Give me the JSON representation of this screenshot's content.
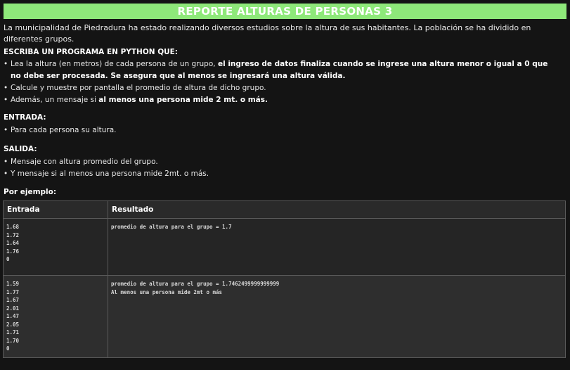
{
  "title": "REPORTE ALTURAS DE PERSONAS 3",
  "intro": "La municipalidad de Piedradura ha estado realizando diversos estudios sobre la altura de sus habitantes. La población se ha dividido en diferentes grupos.",
  "program_heading": "ESCRIBA UN PROGRAMA EN PYTHON QUE:",
  "program_items": [
    {
      "pre": "Lea la altura (en metros) de cada persona de un grupo, ",
      "bold": "el ingreso de datos finaliza cuando se ingrese una altura menor o igual a 0 que no debe ser procesada. Se asegura que al menos se ingresará una altura válida."
    },
    {
      "pre": "Calcule y muestre por pantalla el promedio de altura de dicho grupo.",
      "bold": ""
    },
    {
      "pre": "Además, un mensaje si ",
      "bold": "al menos una persona mide 2 mt. o más."
    }
  ],
  "entrada_heading": "ENTRADA:",
  "entrada_items": [
    "Para cada persona su altura."
  ],
  "salida_heading": "SALIDA:",
  "salida_items": [
    "Mensaje con altura promedio del grupo.",
    "Y mensaje si al menos una persona mide 2mt. o más."
  ],
  "example_heading": "Por ejemplo:",
  "table": {
    "headers": [
      "Entrada",
      "Resultado"
    ],
    "rows": [
      {
        "entrada": [
          "1.68",
          "1.72",
          "1.64",
          "1.76",
          "0"
        ],
        "resultado": [
          "promedio de altura para el grupo = 1.7"
        ]
      },
      {
        "entrada": [
          "1.59",
          "1.77",
          "1.67",
          "2.01",
          "1.47",
          "2.05",
          "1.71",
          "1.70",
          "0"
        ],
        "resultado": [
          "promedio de altura para el grupo = 1.7462499999999999",
          "Al menos una persona mide 2mt o más"
        ]
      }
    ]
  }
}
